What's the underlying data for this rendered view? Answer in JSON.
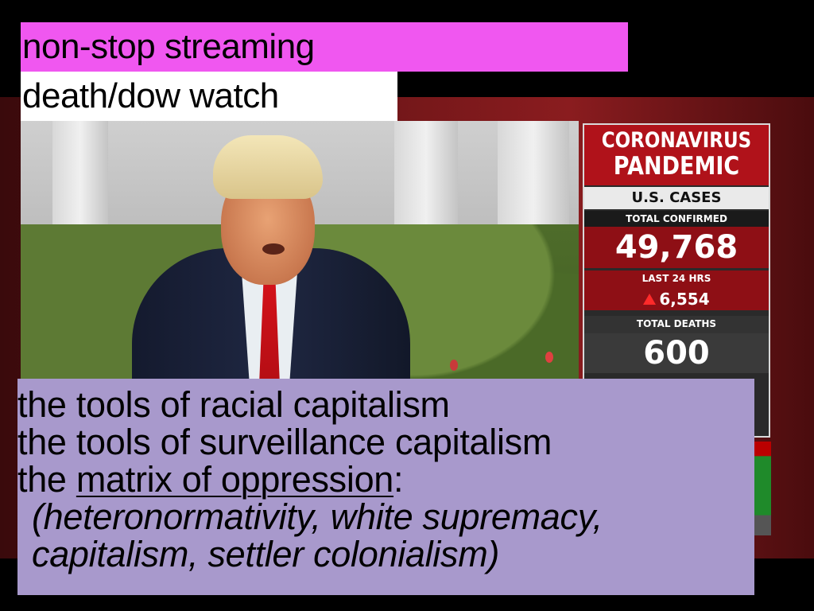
{
  "labels": {
    "top": "non-stop streaming",
    "second": "death/dow watch"
  },
  "news_panel": {
    "title_line1": "CORONAVIRUS",
    "title_line2": "PANDEMIC",
    "us_cases": "U.S. CASES",
    "total_confirmed_label": "TOTAL CONFIRMED",
    "total_confirmed": "49,768",
    "last_24_label": "LAST 24 HRS",
    "last_24": "6,554",
    "total_deaths_label": "TOTAL DEATHS",
    "total_deaths": "600",
    "colors": {
      "red": "#b0121a",
      "dark": "#2a2a2a"
    }
  },
  "caption": {
    "line1": "the tools of racial capitalism",
    "line2": "the tools of surveillance capitalism",
    "line3_prefix": "the ",
    "line3_link": "matrix of oppression",
    "line3_suffix": ":",
    "line4": "(heteronormativity, white supremacy,",
    "line5": "capitalism, settler colonialism)"
  },
  "colors": {
    "pink_label": "#f057f0",
    "white_label": "#ffffff",
    "lavender_box": "#a899cc"
  }
}
